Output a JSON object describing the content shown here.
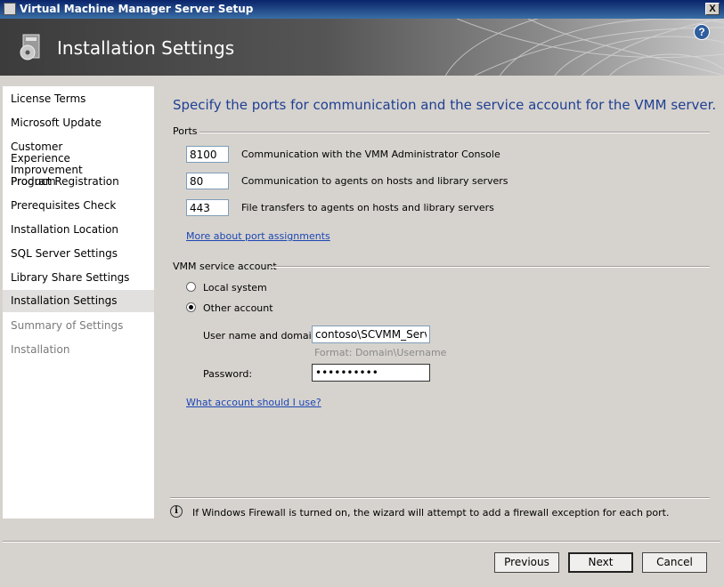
{
  "window": {
    "title": "Virtual Machine Manager Server Setup",
    "close_label": "X"
  },
  "header": {
    "title": "Installation Settings",
    "help_label": "?"
  },
  "nav": {
    "items": [
      {
        "label": "License Terms",
        "state": "normal"
      },
      {
        "label": "Microsoft Update",
        "state": "normal"
      },
      {
        "label": "Customer Experience Improvement Program",
        "state": "normal"
      },
      {
        "label": "Product Registration",
        "state": "normal"
      },
      {
        "label": "Prerequisites Check",
        "state": "normal"
      },
      {
        "label": "Installation Location",
        "state": "normal"
      },
      {
        "label": "SQL Server Settings",
        "state": "normal"
      },
      {
        "label": "Library Share Settings",
        "state": "normal"
      },
      {
        "label": "Installation Settings",
        "state": "active"
      },
      {
        "label": "Summary of Settings",
        "state": "disabled"
      },
      {
        "label": "Installation",
        "state": "disabled"
      }
    ]
  },
  "main": {
    "heading": "Specify the ports for communication and the service account for the VMM server.",
    "ports": {
      "group_label": "Ports",
      "rows": [
        {
          "value": "8100",
          "description": "Communication with the VMM Administrator Console"
        },
        {
          "value": "80",
          "description": "Communication to agents on hosts and library servers"
        },
        {
          "value": "443",
          "description": "File transfers to agents on hosts and library servers"
        }
      ],
      "more_link": "More about port assignments"
    },
    "account": {
      "group_label": "VMM service account",
      "local_system_label": "Local system",
      "other_account_label": "Other account",
      "selected": "Other account",
      "username_label": "User name and domain:",
      "username_value": "contoso\\SCVMM_Service",
      "format_hint": "Format: Domain\\Username",
      "password_label": "Password:",
      "password_value": "••••••••••",
      "help_link": "What account should I use?"
    },
    "info": {
      "icon_glyph": "i",
      "text": "If Windows Firewall is turned on, the wizard will attempt to add a firewall exception for each port."
    }
  },
  "footer": {
    "previous_label": "Previous",
    "next_label": "Next",
    "cancel_label": "Cancel"
  },
  "colors": {
    "heading": "#1f3f93",
    "link": "#1c46b4",
    "titlebar": "#0a246a"
  }
}
